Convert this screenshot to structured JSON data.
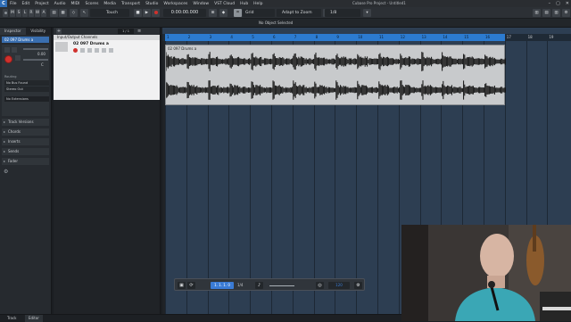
{
  "app": {
    "window_title": "Cubase Pro Project - Untitled1",
    "menu": [
      "File",
      "Edit",
      "Project",
      "Audio",
      "MIDI",
      "Scores",
      "Media",
      "Transport",
      "Studio",
      "Workspaces",
      "Window",
      "VST Cloud",
      "Hub",
      "Help"
    ],
    "logo_letter": "C"
  },
  "toolbar": {
    "toggles": [
      "M",
      "S",
      "L",
      "R",
      "W",
      "A"
    ],
    "tool_mode": "Touch",
    "time": "0:00:00.000",
    "snap": "Grid",
    "zoom": "Adapt to Zoom",
    "quantize": "1/8"
  },
  "status": {
    "message": "No Object Selected"
  },
  "inspector": {
    "tabs": [
      "Inspector",
      "Visibility"
    ],
    "track_name": "02 097 Drums a",
    "sections": [
      "Track Versions",
      "Chords",
      "Inserts",
      "Sends",
      "Fader"
    ],
    "volume": "0.00",
    "pan": "C",
    "input": "No Bus Found",
    "output": "Stereo Out",
    "routing_label": "Routing",
    "extensions_label": "No Extensions"
  },
  "tracklist": {
    "counter": "1 / 1",
    "folder": "Input/Output Channels",
    "track_name": "02 097 Drums a"
  },
  "arrange": {
    "ruler": [
      "1",
      "2",
      "3",
      "4",
      "5",
      "6",
      "7",
      "8",
      "9",
      "10",
      "11",
      "12",
      "13",
      "14",
      "15",
      "16",
      "17",
      "18",
      "19"
    ],
    "event_name": "02 097 Drums a"
  },
  "transport": {
    "position": "1. 1. 1. 0",
    "signature": "1/4",
    "tempo": "120"
  },
  "bottom_tabs": [
    "Track",
    "Editor"
  ],
  "colors": {
    "accent_blue": "#2c7bd0",
    "arrange_bg": "#2d3e52",
    "event_bg": "#c8cacc",
    "record_red": "#d0312d"
  }
}
